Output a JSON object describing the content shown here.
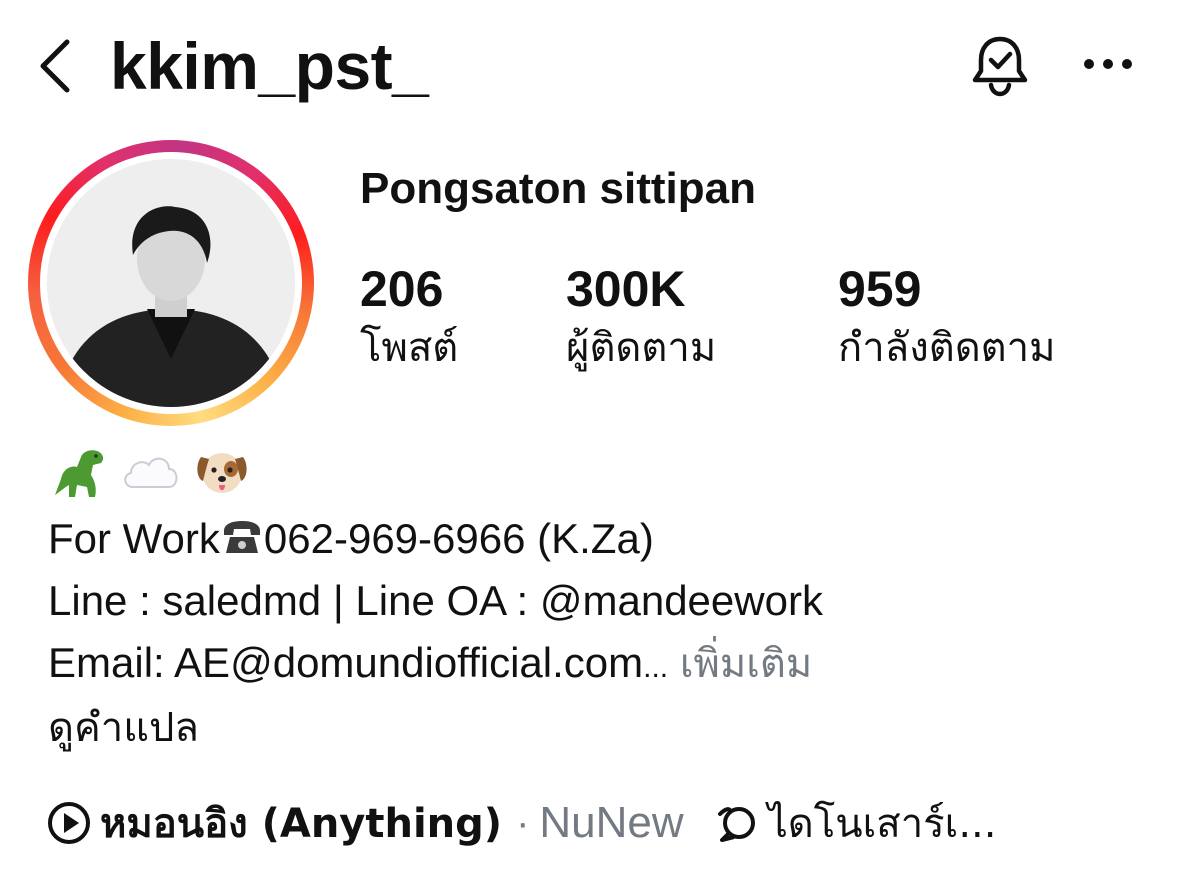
{
  "header": {
    "username": "kkim_pst_",
    "back_icon": "chevron-left-icon",
    "bell_icon": "notification-bell-icon",
    "more_icon": "ellipsis-icon"
  },
  "profile": {
    "display_name": "Pongsaton sittipan",
    "story_ring_colors": [
      "#fcaf45",
      "#f77737",
      "#fd1d1d",
      "#e1306c",
      "#c13584"
    ]
  },
  "stats": [
    {
      "value": "206",
      "label": "โพสต์"
    },
    {
      "value": "300K",
      "label": "ผู้ติดตาม"
    },
    {
      "value": "959",
      "label": "กำลังติดตาม"
    }
  ],
  "bio": {
    "emojis": [
      "dinosaur",
      "cloud",
      "dog-face"
    ],
    "line1_prefix": "For Work",
    "line1_phone": "062-969-6966 (K.Za)",
    "line2": "Line : saledmd | Line OA : @mandeework",
    "line3": "Email: AE@domundiofficial.com",
    "ellipsis": "...",
    "more_label": "เพิ่มเติม",
    "translate_label": "ดูคำแปล",
    "muted_color": "#737a82"
  },
  "music": {
    "title": "หมอนอิง (Anything)",
    "separator": "·",
    "artist": "NuNew",
    "thread_text": "ไดโนเสาร์เ..."
  }
}
